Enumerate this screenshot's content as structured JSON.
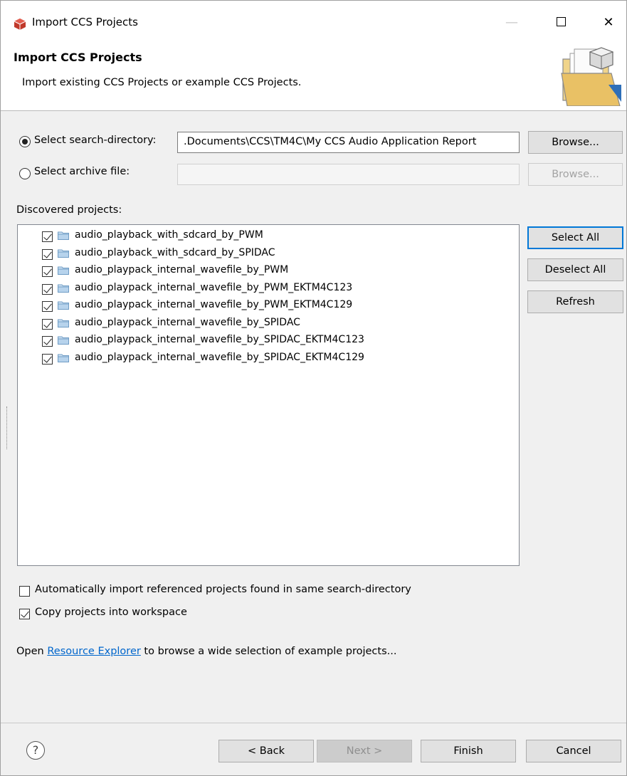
{
  "window": {
    "title": "Import CCS Projects",
    "controls": {
      "minimize": "—",
      "close": "✕"
    }
  },
  "banner": {
    "title": "Import CCS Projects",
    "description": "Import existing CCS Projects or example CCS Projects."
  },
  "source": {
    "directory_label": "Select search-directory:",
    "directory_value": ".Documents\\CCS\\TM4C\\My CCS Audio Application Report",
    "directory_selected": true,
    "directory_browse": "Browse...",
    "archive_label": "Select archive file:",
    "archive_value": "",
    "archive_selected": false,
    "archive_browse": "Browse..."
  },
  "projects": {
    "label": "Discovered projects:",
    "items": [
      {
        "name": "audio_playback_with_sdcard_by_PWM",
        "checked": true
      },
      {
        "name": "audio_playback_with_sdcard_by_SPIDAC",
        "checked": true
      },
      {
        "name": "audio_playpack_internal_wavefile_by_PWM",
        "checked": true
      },
      {
        "name": "audio_playpack_internal_wavefile_by_PWM_EKTM4C123",
        "checked": true
      },
      {
        "name": "audio_playpack_internal_wavefile_by_PWM_EKTM4C129",
        "checked": true
      },
      {
        "name": "audio_playpack_internal_wavefile_by_SPIDAC",
        "checked": true
      },
      {
        "name": "audio_playpack_internal_wavefile_by_SPIDAC_EKTM4C123",
        "checked": true
      },
      {
        "name": "audio_playpack_internal_wavefile_by_SPIDAC_EKTM4C129",
        "checked": true
      }
    ],
    "select_all": "Select All",
    "deselect_all": "Deselect All",
    "refresh": "Refresh"
  },
  "options": {
    "auto_import_label": "Automatically import referenced projects found in same search-directory",
    "auto_import_checked": false,
    "copy_label": "Copy projects into workspace",
    "copy_checked": true
  },
  "info": {
    "prefix": "Open ",
    "link": "Resource Explorer",
    "suffix": " to browse a wide selection of example projects..."
  },
  "footer": {
    "help": "?",
    "back": "< Back",
    "next": "Next >",
    "finish": "Finish",
    "cancel": "Cancel"
  },
  "colors": {
    "accent": "#0078d7",
    "link": "#0066cc",
    "app_icon": "#c0392b"
  }
}
